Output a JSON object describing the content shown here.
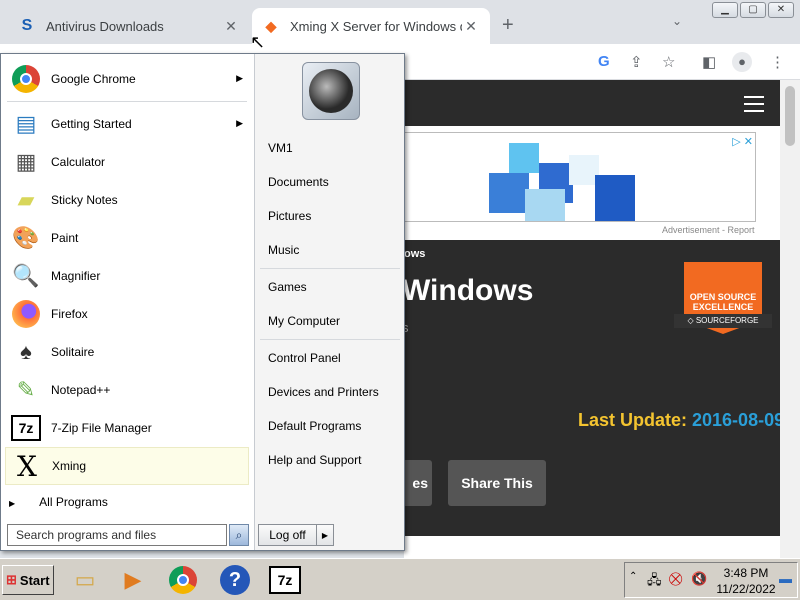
{
  "browser": {
    "tabs": [
      {
        "title": "Antivirus Downloads",
        "favicon": "S"
      },
      {
        "title": "Xming X Server for Windows dov",
        "favicon": "◆"
      }
    ],
    "new_tab": "+",
    "tab_menu": "⌄",
    "toolbar_icons": [
      "google-icon",
      "share-icon",
      "star-icon",
      "sidebar-icon",
      "profile-icon",
      "menu-icon"
    ]
  },
  "page": {
    "ad_choices": "▷ ✕",
    "ad_label": "Advertisement - Report",
    "crumb": "ows",
    "title": "Windows",
    "subtitle": "s",
    "badge": {
      "line1": "OPEN SOURCE",
      "line2": "EXCELLENCE",
      "ribbon": "◇ SOURCEFORGE"
    },
    "last_update_label": "Last Update: ",
    "last_update_value": "2016-08-09",
    "btn1": "es",
    "btn2": "Share This"
  },
  "start_menu": {
    "pinned": [
      {
        "label": "Google Chrome",
        "arrow": true
      },
      {
        "label": "Getting Started",
        "arrow": true
      },
      {
        "label": "Calculator"
      },
      {
        "label": "Sticky Notes"
      },
      {
        "label": "Paint"
      },
      {
        "label": "Magnifier"
      },
      {
        "label": "Firefox"
      },
      {
        "label": "Solitaire"
      },
      {
        "label": "Notepad++"
      },
      {
        "label": "7-Zip File Manager"
      },
      {
        "label": "Xming"
      }
    ],
    "all_programs": "All Programs",
    "search_placeholder": "Search programs and files",
    "right": {
      "user": "VM1",
      "documents": "Documents",
      "pictures": "Pictures",
      "music": "Music",
      "games": "Games",
      "computer": "My Computer",
      "control_panel": "Control Panel",
      "devices": "Devices and Printers",
      "default_programs": "Default Programs",
      "help": "Help and Support"
    },
    "log_off": "Log off"
  },
  "taskbar": {
    "start": "Start",
    "time": "3:48 PM",
    "date": "11/22/2022"
  }
}
